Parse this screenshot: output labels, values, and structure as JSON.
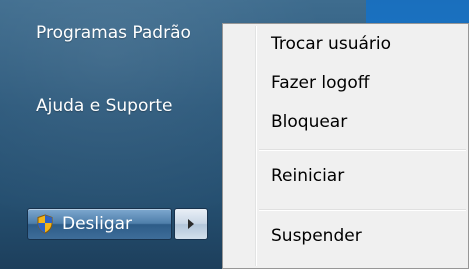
{
  "start_menu": {
    "links": [
      {
        "label": "Programas Padrão"
      },
      {
        "label": "Ajuda e Suporte"
      }
    ],
    "shutdown": {
      "label": "Desligar",
      "shield_icon": "uac-shield-icon",
      "arrow_icon": "triangle-right-icon"
    }
  },
  "context_menu": {
    "items": [
      {
        "label": "Trocar usuário"
      },
      {
        "label": "Fazer logoff"
      },
      {
        "label": "Bloquear"
      },
      {
        "label": "Reiniciar"
      },
      {
        "label": "Suspender"
      }
    ]
  },
  "colors": {
    "menu_bg": "#f0f0f0",
    "pane_bg": "#2b587b",
    "desktop": "#1b72c2"
  }
}
